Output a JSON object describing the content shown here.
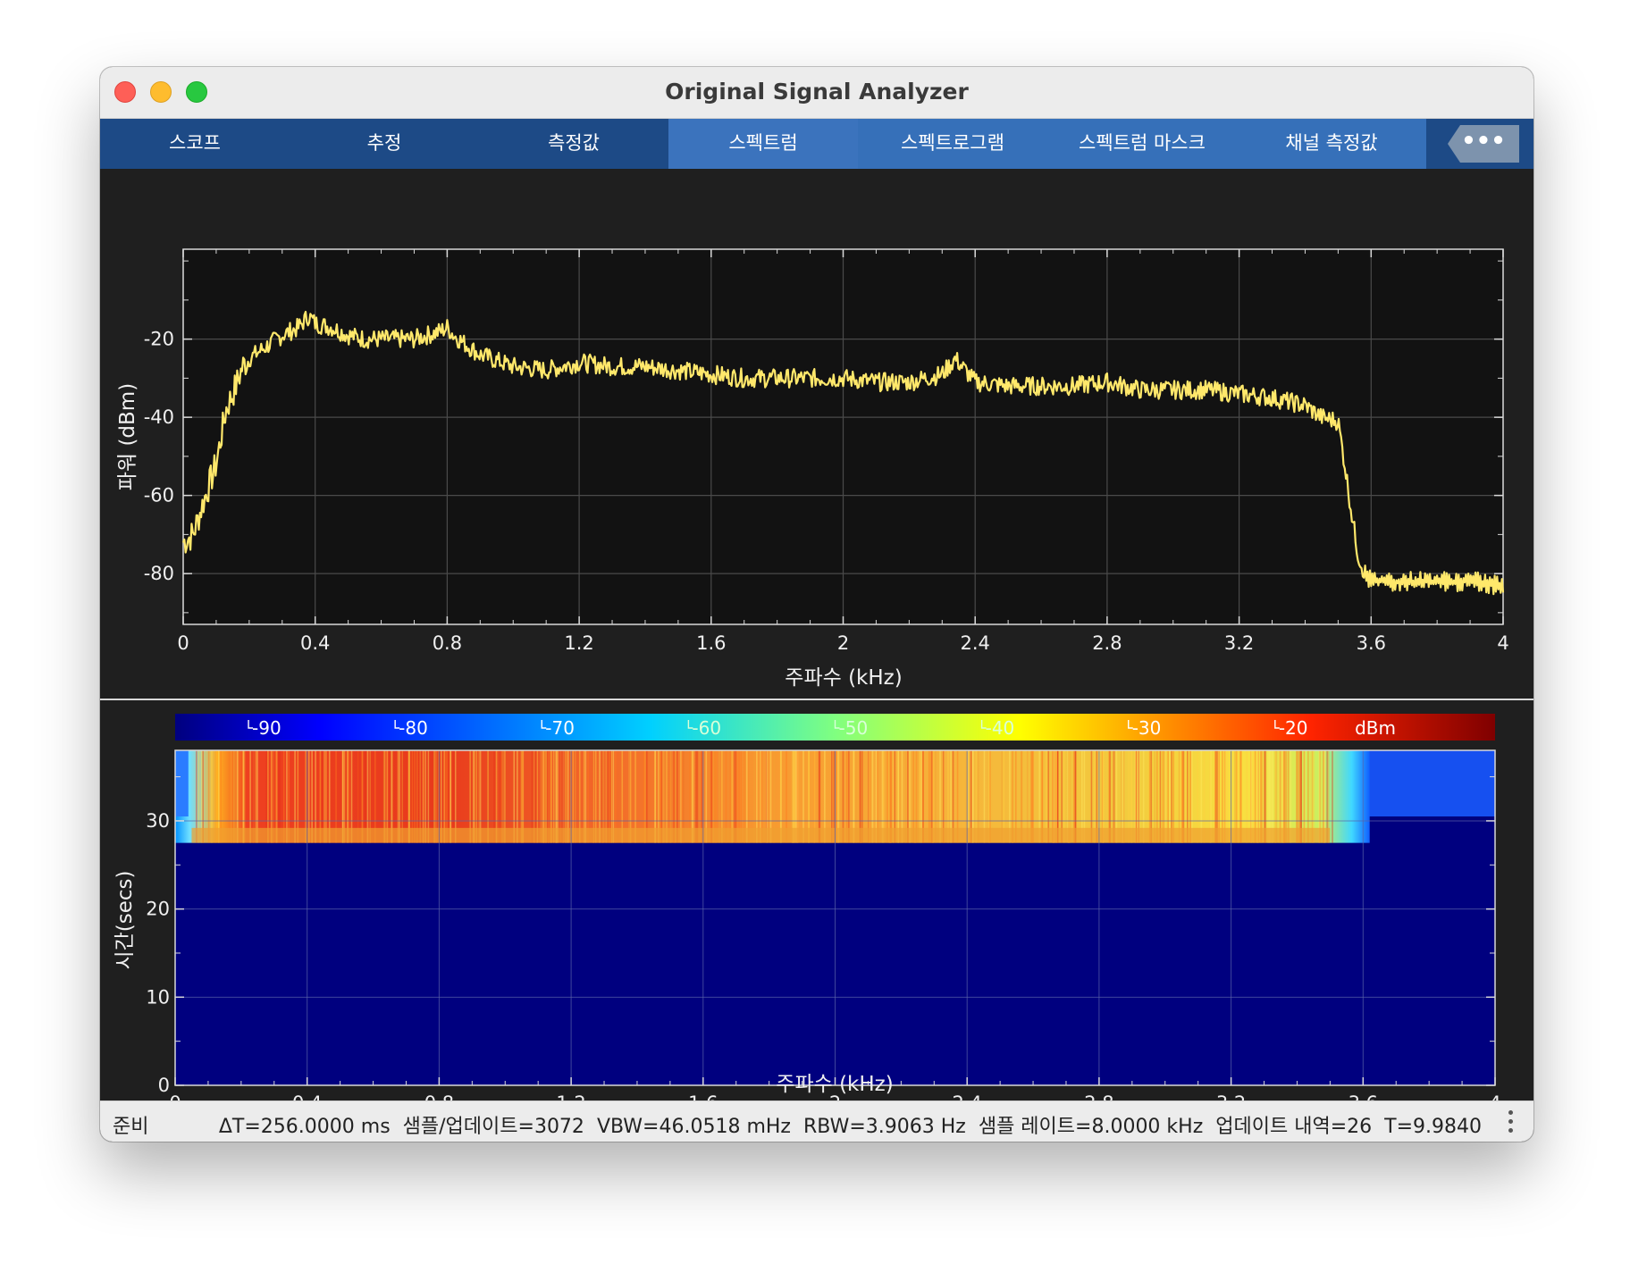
{
  "window": {
    "title": "Original Signal Analyzer"
  },
  "tabs": [
    {
      "label": "스코프",
      "active": false
    },
    {
      "label": "추정",
      "active": false
    },
    {
      "label": "측정값",
      "active": false
    },
    {
      "label": "스펙트럼",
      "active": true
    },
    {
      "label": "스펙트로그램",
      "active": true
    },
    {
      "label": "스펙트럼 마스크",
      "active": true
    },
    {
      "label": "채널 측정값",
      "active": true
    }
  ],
  "overflow_button": "•••",
  "colors": {
    "tabbar": "#1d4a86",
    "tab_active": "#3b73bd",
    "trace": "#ffe86b",
    "plot_bg": "#121212",
    "spectrogram_bg": "#00007f"
  },
  "chart_data": [
    {
      "type": "line",
      "title": "",
      "xlabel": "주파수 (kHz)",
      "ylabel": "파워 (dBm)",
      "xlim": [
        0,
        4
      ],
      "ylim": [
        -93,
        3
      ],
      "xticks": [
        "0",
        "0.4",
        "0.8",
        "1.2",
        "1.6",
        "2",
        "2.4",
        "2.8",
        "3.2",
        "3.6",
        "4"
      ],
      "yticks": [
        "-20",
        "-40",
        "-60",
        "-80"
      ],
      "grid": true,
      "series": [
        {
          "x": [
            0,
            0.03,
            0.06,
            0.1,
            0.13,
            0.16,
            0.18,
            0.2,
            0.25,
            0.3,
            0.35,
            0.38,
            0.4,
            0.45,
            0.5,
            0.55,
            0.6,
            0.7,
            0.78,
            0.8,
            0.82,
            0.85,
            0.9,
            1.0,
            1.1,
            1.2,
            1.3,
            1.4,
            1.5,
            1.6,
            1.7,
            1.8,
            1.9,
            2.0,
            2.1,
            2.2,
            2.3,
            2.34,
            2.4,
            2.5,
            2.6,
            2.7,
            2.8,
            2.9,
            3.0,
            3.1,
            3.2,
            3.3,
            3.4,
            3.45,
            3.5,
            3.52,
            3.54,
            3.56,
            3.58,
            3.6,
            3.7,
            3.8,
            3.9,
            4.0
          ],
          "y": [
            -72,
            -70,
            -62,
            -52,
            -38,
            -32,
            -27,
            -25,
            -22,
            -19,
            -17,
            -14,
            -16,
            -17,
            -19,
            -20,
            -20,
            -20,
            -18,
            -17,
            -19,
            -21,
            -24,
            -27,
            -28,
            -26,
            -27,
            -27,
            -28,
            -29,
            -30,
            -30,
            -30,
            -30,
            -31,
            -31,
            -29,
            -25,
            -31,
            -32,
            -32,
            -32,
            -31,
            -33,
            -33,
            -33,
            -34,
            -35,
            -37,
            -40,
            -41,
            -52,
            -64,
            -75,
            -80,
            -82,
            -82,
            -82,
            -82,
            -83
          ]
        }
      ]
    },
    {
      "type": "heatmap",
      "title": "",
      "xlabel": "주파수 (kHz)",
      "ylabel": "시간(secs)",
      "xlim": [
        0,
        4
      ],
      "ylim": [
        0,
        38
      ],
      "xticks": [
        "0",
        "0.4",
        "0.8",
        "1.2",
        "1.6",
        "2",
        "2.4",
        "2.8",
        "3.2",
        "3.6",
        "4"
      ],
      "yticks": [
        "0",
        "10",
        "20",
        "30"
      ],
      "colorbar": {
        "ticks": [
          "-90",
          "-80",
          "-70",
          "-60",
          "-50",
          "-40",
          "-30",
          "-20"
        ],
        "unit": "dBm",
        "range": [
          -95,
          -5
        ]
      },
      "filled_time_range": [
        27.5,
        38
      ],
      "filled_freq_range": [
        0,
        3.62
      ]
    }
  ],
  "status": {
    "state": "준비",
    "delta_t": "ΔT=256.0000 ms",
    "samples": "샘플/업데이트=3072",
    "vbw": "VBW=46.0518 mHz",
    "rbw": "RBW=3.9063 Hz",
    "sample_rate": "샘플 레이트=8.0000 kHz",
    "update_history": "업데이트 내역=26",
    "t": "T=9.9840"
  }
}
